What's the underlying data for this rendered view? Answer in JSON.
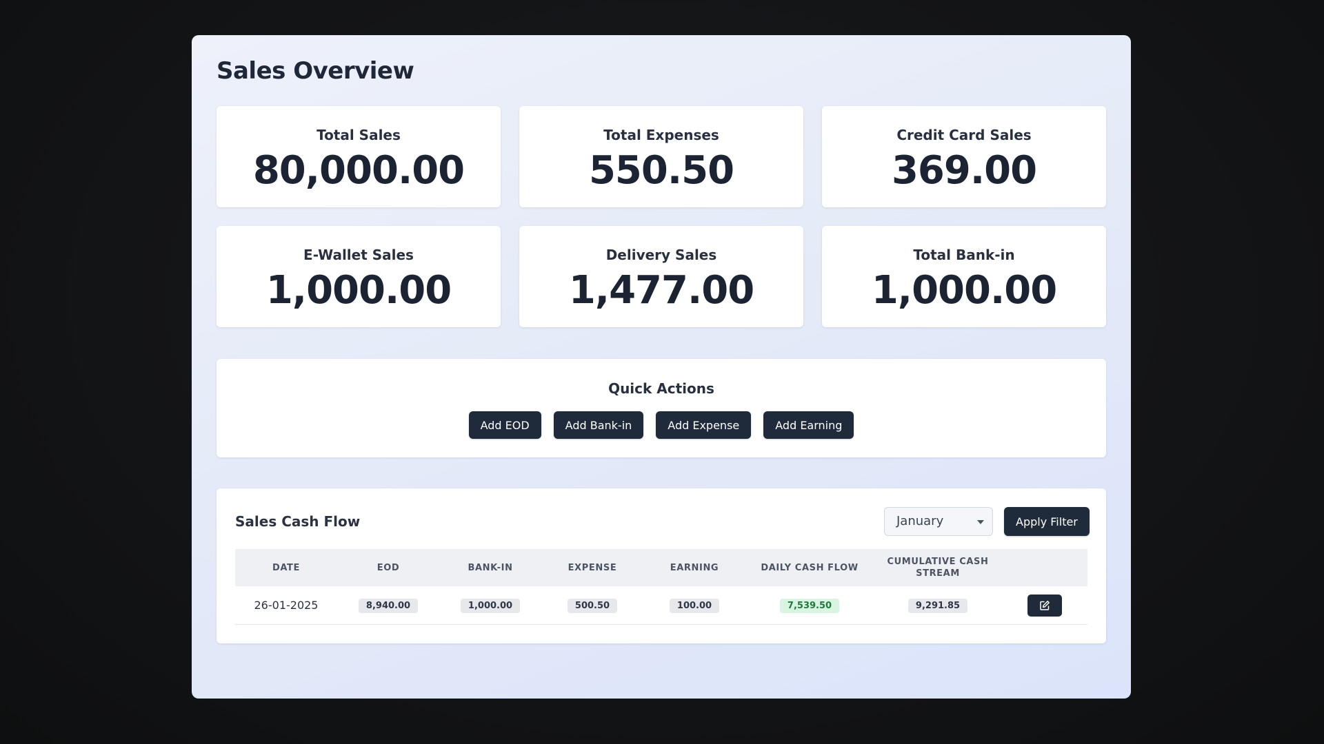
{
  "page": {
    "title": "Sales Overview"
  },
  "stats": [
    {
      "label": "Total Sales",
      "value": "80,000.00"
    },
    {
      "label": "Total Expenses",
      "value": "550.50"
    },
    {
      "label": "Credit Card Sales",
      "value": "369.00"
    },
    {
      "label": "E-Wallet Sales",
      "value": "1,000.00"
    },
    {
      "label": "Delivery Sales",
      "value": "1,477.00"
    },
    {
      "label": "Total Bank-in",
      "value": "1,000.00"
    }
  ],
  "quick_actions": {
    "title": "Quick Actions",
    "buttons": [
      "Add EOD",
      "Add Bank-in",
      "Add Expense",
      "Add Earning"
    ]
  },
  "cash_flow": {
    "title": "Sales Cash Flow",
    "month_selected": "January",
    "apply_label": "Apply Filter",
    "columns": [
      "Date",
      "EOD",
      "Bank-in",
      "Expense",
      "Earning",
      "Daily Cash Flow",
      "Cumulative Cash Stream",
      ""
    ],
    "rows": [
      {
        "date": "26-01-2025",
        "eod": "8,940.00",
        "bank_in": "1,000.00",
        "expense": "500.50",
        "earning": "100.00",
        "daily_cash_flow": "7,539.50",
        "cumulative": "9,291.85"
      }
    ],
    "edit_icon": "edit-icon"
  },
  "colors": {
    "accent_dark": "#1f2a3a",
    "positive_bg": "#d9f5e1",
    "positive_text": "#1e7a3d"
  }
}
